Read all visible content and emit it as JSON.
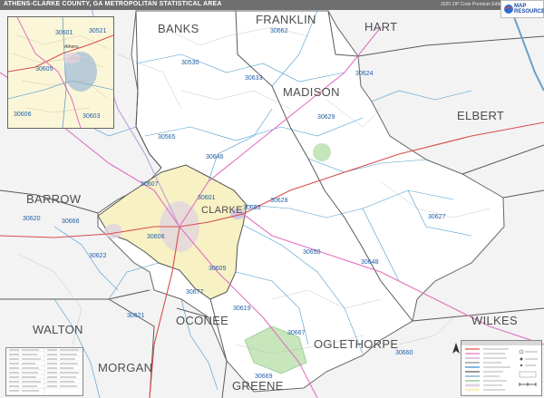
{
  "map": {
    "title": "ATHENS-CLARKE COUNTY, GA METROPOLITAN STATISTICAL AREA",
    "edition": "2020 ZIP Code Premium Edition",
    "publisher": "MAP RESOURCES",
    "counties": [
      {
        "name": "BANKS"
      },
      {
        "name": "FRANKLIN"
      },
      {
        "name": "HART"
      },
      {
        "name": "MADISON"
      },
      {
        "name": "ELBERT"
      },
      {
        "name": "BARROW"
      },
      {
        "name": "CLARKE"
      },
      {
        "name": "WALTON"
      },
      {
        "name": "OCONEE"
      },
      {
        "name": "OGLETHORPE"
      },
      {
        "name": "WILKES"
      },
      {
        "name": "MORGAN"
      },
      {
        "name": "GREENE"
      }
    ],
    "zip_codes": [
      "30521",
      "30662",
      "30624",
      "30530",
      "30633",
      "30629",
      "30565",
      "30646",
      "30607",
      "30601",
      "30683",
      "30628",
      "30627",
      "30666",
      "30620",
      "30622",
      "30606",
      "30605",
      "30650",
      "30648",
      "30677",
      "30621",
      "30619",
      "30667",
      "30669",
      "30660",
      "30601",
      "30603",
      "30606",
      "30605",
      "30622",
      "30662"
    ],
    "inset": {
      "city_label": "Athens",
      "zips": [
        "30601",
        "30605",
        "30606",
        "30603"
      ]
    },
    "colors": {
      "clarke_fill": "#f7f1c4",
      "county_boundary": "#555555",
      "zip_boundary": "#2a8ac4",
      "highway": "#e05050",
      "road_pink": "#e070c0",
      "park": "#bfe3b4",
      "urban": "#d8c4d8",
      "outside": "#f3f3f3",
      "water": "#6aa0c8"
    }
  }
}
